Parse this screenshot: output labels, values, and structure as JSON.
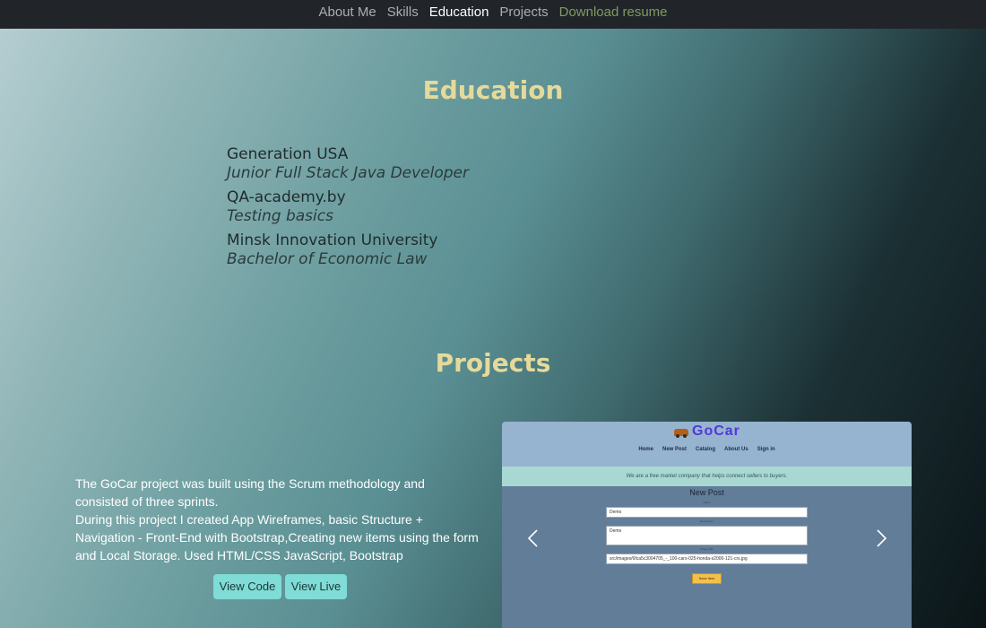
{
  "nav": {
    "items": [
      "About Me",
      "Skills",
      "Education",
      "Projects"
    ],
    "active": "Education",
    "resume_label": "Download resume",
    "resume_color": "#7f9a63"
  },
  "education": {
    "title": "Education",
    "items": [
      {
        "school": "Generation USA",
        "degree": "Junior Full Stack Java Developer"
      },
      {
        "school": "QA-academy.by",
        "degree": "Testing basics"
      },
      {
        "school": "Minsk Innovation University",
        "degree": "Bachelor of Economic Law"
      }
    ]
  },
  "projects": {
    "title": "Projects",
    "description": [
      "The GoCar project was built using the Scrum methodology and consisted of three sprints.",
      "During this project I created App Wireframes, basic Structure + Navigation - Front-End with Bootstrap,Creating new items using the form and Local Storage. Used HTML/CSS JavaScript, Bootstrap"
    ],
    "buttons": {
      "view_code": "View Code",
      "view_live": "View Live"
    },
    "button_color": "#7fdcd6",
    "carousel": {
      "prev_icon": "chevron-left-icon",
      "next_icon": "chevron-right-icon",
      "slide": {
        "logo_icon": "car-icon",
        "logo_text": "GoCar",
        "nav": [
          "Home",
          "New Post",
          "Catalog",
          "About Us",
          "Sign in"
        ],
        "tagline": "We are a free market company that helps connect sellers to buyers.",
        "form_title": "New Post",
        "fields": [
          {
            "label": "Name",
            "value": "Demo"
          },
          {
            "label": "Description",
            "value": "Demo"
          },
          {
            "label": "Image URL",
            "value": "src/images/6fca5c3004705_-_100-cars-025-honda-s2000-121-crs.jpg"
          }
        ],
        "save_label": "Save item"
      }
    }
  },
  "colors": {
    "heading": "#e5da9a",
    "navbar_bg": "#212529"
  }
}
